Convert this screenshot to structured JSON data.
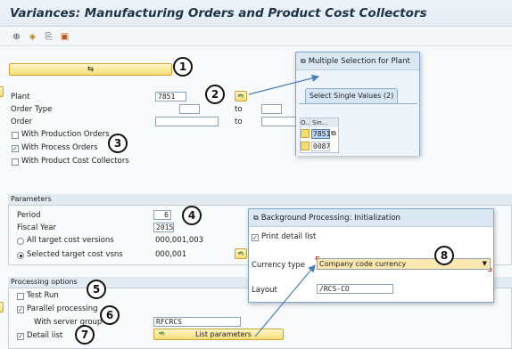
{
  "title": "Variances: Manufacturing Orders and Product Cost Collectors",
  "toolbar": {
    "icons": [
      "execute-icon",
      "variant-icon",
      "get-variant-icon",
      "save-variant-icon"
    ]
  },
  "selection": {
    "plant_label": "Plant",
    "plant_value": "7851",
    "order_type_label": "Order Type",
    "order_label": "Order",
    "to_label": "to",
    "with_production_orders": "With Production Orders",
    "with_process_orders": "With Process Orders",
    "with_product_cost_collectors": "With Product Cost Collectors"
  },
  "parameters": {
    "header": "Parameters",
    "period_label": "Period",
    "period_value": "6",
    "fiscal_year_label": "Fiscal Year",
    "fiscal_year_value": "2015",
    "all_versions_label": "All target cost versions",
    "all_versions_value": "000,001,003",
    "selected_versions_label": "Selected target cost vsns",
    "selected_versions_value": "000,001"
  },
  "processing": {
    "header": "Processing options",
    "test_run": "Test Run",
    "parallel": "Parallel processing",
    "server_group_label": "With server group",
    "server_group_value": "RFCRCS",
    "detail_list": "Detail list",
    "list_parameters": "List parameters"
  },
  "plant_popup": {
    "title": "Multiple Selection for Plant",
    "tab": "Select Single Values (2)",
    "col_o": "O..",
    "col_sin": "Sin...",
    "values": [
      "7851",
      "0087"
    ]
  },
  "bg_popup": {
    "title": "Background Processing: Initialization",
    "print_detail": "Print detail list",
    "currency_label": "Currency type",
    "currency_value": "Company code currency",
    "layout_label": "Layout",
    "layout_value": "/RCS-CO"
  },
  "callouts": [
    "1",
    "2",
    "3",
    "4",
    "5",
    "6",
    "7",
    "8"
  ]
}
